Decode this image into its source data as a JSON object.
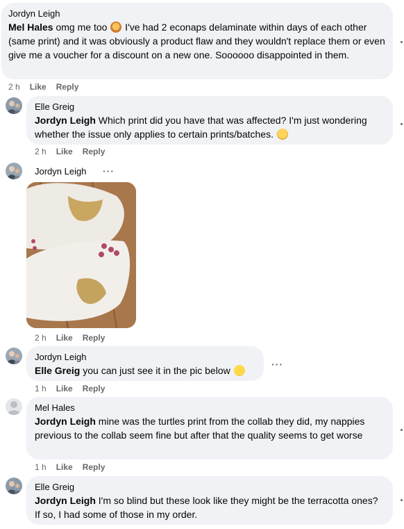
{
  "comments": [
    {
      "author": "Jordyn Leigh",
      "mention": "Mel Hales",
      "text_before_emoji": " omg me too ",
      "emoji": "face-palm-emoji",
      "text_after_emoji": " I've had 2 econaps delaminate within days of each other (same print) and it was obviously a product flaw and they wouldn't replace them or even give me a voucher for a discount on a new one. Soooooo disappointed in them.",
      "time": "2 h",
      "like": "Like",
      "reply": "Reply"
    },
    {
      "author": "Elle Greig",
      "mention": "Jordyn Leigh",
      "text": " Which print did you have that was affected? I'm just wondering whether the issue only applies to certain prints/batches.",
      "emoji": "thinking-face-emoji",
      "time": "2 h",
      "like": "Like",
      "reply": "Reply"
    },
    {
      "author": "Jordyn Leigh",
      "more": "···",
      "photo": "cloth-nappy-photo",
      "time": "2 h",
      "like": "Like",
      "reply": "Reply"
    },
    {
      "author": "Jordyn Leigh",
      "mention": "Elle Greig",
      "text": " you can just see it in the pic below",
      "emoji": "smiling-face-emoji",
      "more": "···",
      "time": "1 h",
      "like": "Like",
      "reply": "Reply"
    },
    {
      "author": "Mel Hales",
      "mention": "Jordyn Leigh",
      "text": " mine was the turtles print from the collab they did, my nappies previous to the collab seem fine but after that the quality seems to get worse",
      "time": "1 h",
      "like": "Like",
      "reply": "Reply"
    },
    {
      "author": "Elle Greig",
      "mention": "Jordyn Leigh",
      "text": " I'm so blind but these look like they might be the terracotta ones? If so, I had some of those in my order."
    }
  ],
  "colors": {
    "bubble": "#f0f2f5",
    "meta": "#65676b",
    "text": "#050505"
  }
}
